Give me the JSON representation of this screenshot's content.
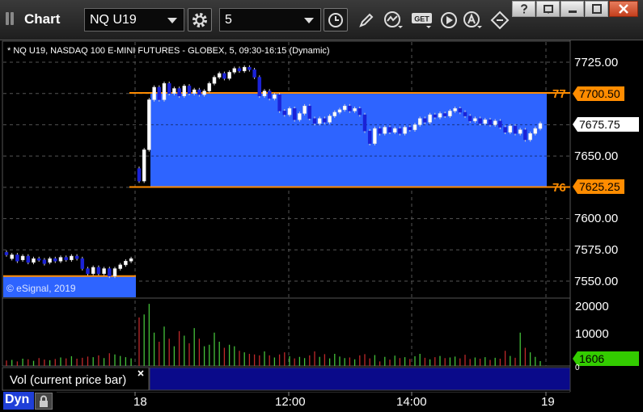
{
  "window": {
    "title": "Chart",
    "symbol": "NQ U19",
    "interval": "5"
  },
  "chart_header": "* NQ U19, NASDAQ 100 E-MINI FUTURES - GLOBEX, 5, 09:30-16:15 (Dynamic)",
  "watermark": "© eSignal, 2019",
  "price_axis": {
    "ticks": [
      "7725.00",
      "7650.00",
      "7600.00",
      "7575.00",
      "7550.00"
    ]
  },
  "price_flags": {
    "upper_line_label": "77",
    "upper_line_value": "7700.50",
    "current_value": "7675.75",
    "lower_line_label": "76",
    "lower_line_value": "7625.25"
  },
  "volume_axis": {
    "ticks": [
      "20000",
      "10000",
      "0"
    ],
    "current_value": "1606"
  },
  "volume_label": "Vol (current price bar)",
  "time_axis": {
    "ticks": [
      "18",
      "12:00",
      "14:00",
      "19"
    ]
  },
  "bottom": {
    "mode_label": "Dyn"
  },
  "colors": {
    "box_fill": "#2e64ff",
    "line_orange": "#ff8c00",
    "flag_orange": "#ff8c00",
    "current_flag": "#ffffff",
    "volume_flag": "#33cc00",
    "vol_up": "#44c23a",
    "vol_down": "#c0282a",
    "candle_up": "#ffffff",
    "candle_down": "#1b22d6"
  },
  "chart_data": {
    "type": "candlestick",
    "y_range": [
      7540,
      7735
    ],
    "volume_range": [
      0,
      22000
    ],
    "box": {
      "top": 7700.5,
      "bottom": 7625.25
    },
    "prev_day_line": 7554,
    "prev_day_candles": [
      [
        7573,
        7571
      ],
      [
        7568,
        7571
      ],
      [
        7571,
        7566
      ],
      [
        7567,
        7570
      ],
      [
        7570,
        7565
      ],
      [
        7565,
        7568
      ],
      [
        7568,
        7567
      ],
      [
        7567,
        7564
      ],
      [
        7565,
        7568
      ],
      [
        7568,
        7566
      ],
      [
        7566,
        7569
      ],
      [
        7569,
        7567
      ],
      [
        7567,
        7570
      ],
      [
        7570,
        7568
      ],
      [
        7568,
        7560
      ],
      [
        7560,
        7556
      ],
      [
        7556,
        7561
      ],
      [
        7561,
        7556
      ],
      [
        7556,
        7560
      ],
      [
        7560,
        7554
      ],
      [
        7554,
        7560
      ],
      [
        7560,
        7563
      ],
      [
        7563,
        7566
      ],
      [
        7566,
        7568
      ]
    ],
    "day_candles": [
      [
        7640,
        7630
      ],
      [
        7630,
        7655
      ],
      [
        7655,
        7695
      ],
      [
        7695,
        7705
      ],
      [
        7705,
        7695
      ],
      [
        7695,
        7708
      ],
      [
        7708,
        7700
      ],
      [
        7700,
        7704
      ],
      [
        7704,
        7698
      ],
      [
        7698,
        7706
      ],
      [
        7706,
        7700
      ],
      [
        7700,
        7703
      ],
      [
        7703,
        7699
      ],
      [
        7699,
        7702
      ],
      [
        7702,
        7708
      ],
      [
        7708,
        7713
      ],
      [
        7713,
        7716
      ],
      [
        7716,
        7712
      ],
      [
        7712,
        7717
      ],
      [
        7717,
        7720
      ],
      [
        7720,
        7718
      ],
      [
        7718,
        7721
      ],
      [
        7721,
        7719
      ],
      [
        7719,
        7713
      ],
      [
        7713,
        7698
      ],
      [
        7698,
        7702
      ],
      [
        7702,
        7696
      ],
      [
        7696,
        7699
      ],
      [
        7699,
        7686
      ],
      [
        7686,
        7683
      ],
      [
        7683,
        7688
      ],
      [
        7688,
        7679
      ],
      [
        7679,
        7684
      ],
      [
        7684,
        7690
      ],
      [
        7690,
        7680
      ],
      [
        7680,
        7676
      ],
      [
        7676,
        7680
      ],
      [
        7680,
        7677
      ],
      [
        7677,
        7682
      ],
      [
        7682,
        7685
      ],
      [
        7685,
        7687
      ],
      [
        7687,
        7690
      ],
      [
        7690,
        7686
      ],
      [
        7686,
        7688
      ],
      [
        7688,
        7683
      ],
      [
        7683,
        7670
      ],
      [
        7670,
        7660
      ],
      [
        7660,
        7672
      ],
      [
        7672,
        7668
      ],
      [
        7668,
        7673
      ],
      [
        7673,
        7669
      ],
      [
        7669,
        7672
      ],
      [
        7672,
        7668
      ],
      [
        7668,
        7673
      ],
      [
        7673,
        7671
      ],
      [
        7671,
        7675
      ],
      [
        7675,
        7680
      ],
      [
        7680,
        7677
      ],
      [
        7677,
        7683
      ],
      [
        7683,
        7681
      ],
      [
        7681,
        7684
      ],
      [
        7684,
        7682
      ],
      [
        7682,
        7686
      ],
      [
        7686,
        7688
      ],
      [
        7688,
        7685
      ],
      [
        7685,
        7682
      ],
      [
        7682,
        7678
      ],
      [
        7678,
        7680
      ],
      [
        7680,
        7676
      ],
      [
        7676,
        7679
      ],
      [
        7679,
        7675
      ],
      [
        7675,
        7678
      ],
      [
        7678,
        7673
      ],
      [
        7673,
        7669
      ],
      [
        7669,
        7674
      ],
      [
        7674,
        7668
      ],
      [
        7668,
        7671
      ],
      [
        7671,
        7663
      ],
      [
        7663,
        7668
      ],
      [
        7668,
        7672
      ],
      [
        7672,
        7676
      ]
    ],
    "prev_day_volume": [
      1800,
      2000,
      1500,
      2400,
      2200,
      1700,
      2600,
      2100,
      1900,
      2300,
      2800,
      2500,
      3200,
      2400,
      2700,
      3100,
      2900,
      3500,
      2600,
      4200,
      3800,
      3300,
      2900,
      2500
    ],
    "day_volume": [
      16000,
      17000,
      20500,
      11000,
      8000,
      13000,
      9000,
      6500,
      11500,
      10000,
      7500,
      12500,
      9000,
      6500,
      7000,
      11000,
      8000,
      6000,
      7000,
      6500,
      5000,
      4500,
      4000,
      3800,
      3500,
      4800,
      3500,
      2800,
      3800,
      4500,
      3200,
      2500,
      3000,
      2600,
      3500,
      4800,
      3000,
      3900,
      2500,
      4000,
      3100,
      2600,
      2800,
      2200,
      3500,
      3900,
      2500,
      3600,
      1500,
      3000,
      2100,
      3400,
      2600,
      2900,
      2300,
      3200,
      4000,
      2700,
      2200,
      2900,
      3300,
      2600,
      2800,
      3100,
      2500,
      3700,
      2300,
      2800,
      2400,
      2900,
      2000,
      2700,
      2400,
      5000,
      3300,
      2700,
      11000,
      6000,
      4500,
      3000,
      1606
    ]
  }
}
